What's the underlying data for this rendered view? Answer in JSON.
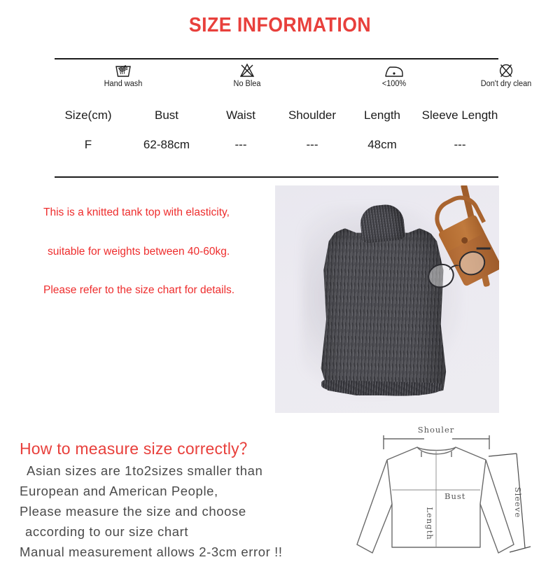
{
  "title": "SIZE INFORMATION",
  "colors": {
    "title_red": "#e8403c",
    "description_red": "#ee2d2d",
    "rule_black": "#1c1c1c",
    "body_gray": "#4a4a4a"
  },
  "care_symbols": [
    {
      "icon": "hand-wash-icon",
      "label": "Hand wash"
    },
    {
      "icon": "no-bleach-icon",
      "label": "No Blea"
    },
    {
      "icon": "iron-low-icon",
      "label": "<100%"
    },
    {
      "icon": "no-dry-clean-icon",
      "label": "Don't dry clean"
    }
  ],
  "size_table": {
    "headers": [
      "Size(cm)",
      "Bust",
      "Waist",
      "Shoulder",
      "Length",
      "Sleeve Length"
    ],
    "rows": [
      [
        "F",
        "62-88cm",
        "---",
        "---",
        "48cm",
        "---"
      ]
    ]
  },
  "description": [
    "This is a knitted tank top with elasticity,",
    "suitable for weights between 40-60kg.",
    "Please refer to the size chart for details."
  ],
  "photo": {
    "alt": "dark gray ribbed sleeveless turtleneck knit top flat lay with tan leather bag and eyeglasses"
  },
  "howto": {
    "heading": "How to measure size correctly？",
    "lines": [
      "Asian sizes are 1to2sizes smaller than",
      "European and American People,",
      "Please measure the size and choose",
      "according to our size chart",
      "Manual measurement allows 2-3cm error !!"
    ]
  },
  "diagram": {
    "labels": {
      "shoulder": "Shouler",
      "bust": "Bust",
      "length": "Length",
      "sleeve": "Sleeve"
    }
  }
}
